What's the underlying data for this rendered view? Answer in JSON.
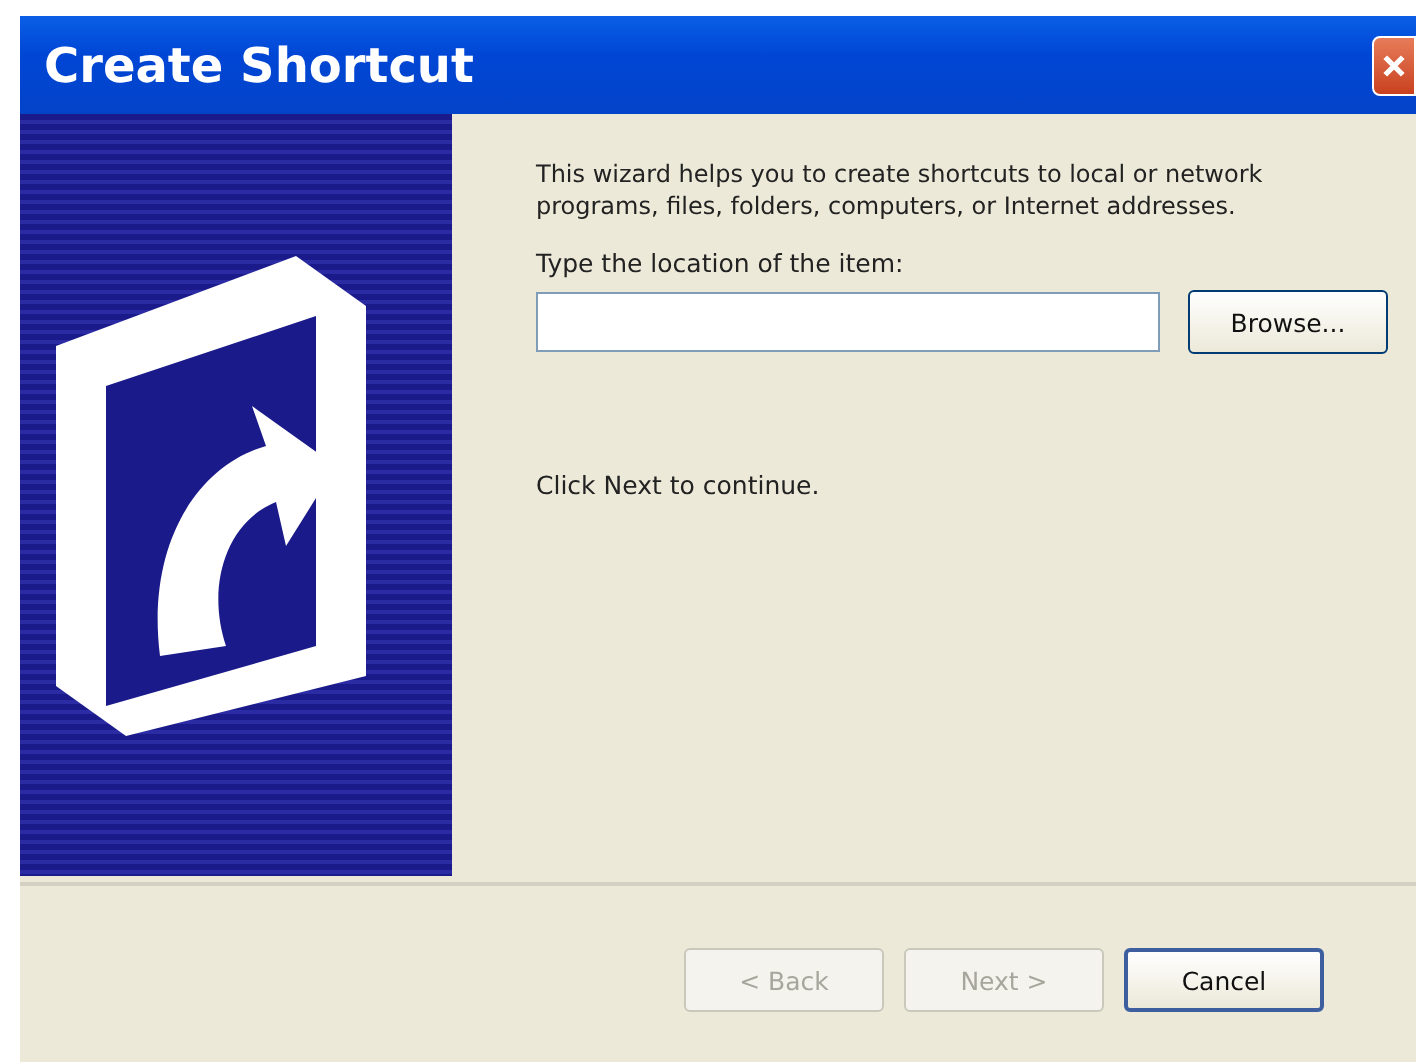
{
  "window": {
    "title": "Create Shortcut"
  },
  "intro": "This wizard helps you to create shortcuts to local or network programs, files, folders, computers, or Internet addresses.",
  "location": {
    "label": "Type the location of the item:"
  },
  "browse_button": {
    "label": "Browse...",
    "disabled": false
  },
  "hint": "Click Next to continue.",
  "buttons": [
    {
      "label": "< Back",
      "disabled": true,
      "default": false
    },
    {
      "label": "Next >",
      "disabled": true,
      "default": false
    },
    {
      "label": "Cancel",
      "disabled": false,
      "default": true
    }
  ]
}
